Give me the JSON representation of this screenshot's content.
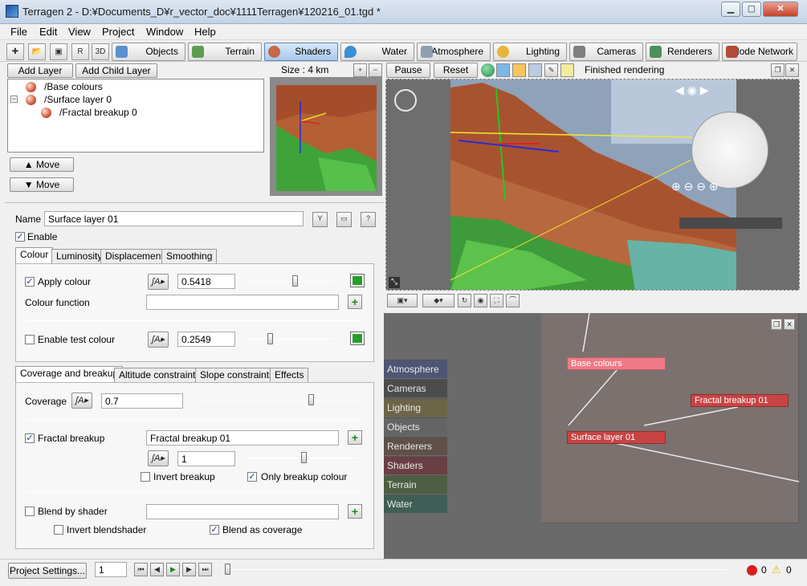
{
  "window": {
    "title": "Terragen 2 - D:¥Documents_D¥r_vector_doc¥1111Terragen¥120216_01.tgd *"
  },
  "menu": [
    "File",
    "Edit",
    "View",
    "Project",
    "Window",
    "Help"
  ],
  "tabs": [
    {
      "label": "Objects",
      "color": "#5a8fd0"
    },
    {
      "label": "Terrain",
      "color": "#5d9c52"
    },
    {
      "label": "Shaders",
      "color": "#c8674a"
    },
    {
      "label": "Water",
      "color": "#3b8fd6"
    },
    {
      "label": "Atmosphere",
      "color": "#8f9fb2"
    },
    {
      "label": "Lighting",
      "color": "#e9b43b"
    },
    {
      "label": "Cameras",
      "color": "#7f7f7f"
    },
    {
      "label": "Renderers",
      "color": "#4c8f5c"
    },
    {
      "label": "Node Network",
      "color": "#b24a3a"
    }
  ],
  "layers": {
    "add_layer": "Add Layer",
    "add_child_layer": "Add Child Layer",
    "items": [
      "/Base colours",
      "/Surface layer 0",
      "/Fractal breakup 0"
    ],
    "move_up": "Move",
    "move_down": "Move"
  },
  "preview": {
    "size_label": "Size : 4 km"
  },
  "render_bar": {
    "pause": "Pause",
    "reset": "Reset",
    "status": "Finished rendering"
  },
  "props": {
    "name_label": "Name",
    "name_value": "Surface layer 01",
    "enable_label": "Enable",
    "tabs1": [
      "Colour",
      "Luminosity",
      "Displacement",
      "Smoothing"
    ],
    "apply_colour": "Apply colour",
    "apply_value": "0.5418",
    "apply_fraction": 0.54,
    "colour_function": "Colour function",
    "enable_test": "Enable test colour",
    "test_value": "0.2549",
    "test_fraction": 0.25,
    "tabs2": [
      "Coverage and breakup",
      "Altitude constraints",
      "Slope constraints",
      "Effects"
    ],
    "coverage_label": "Coverage",
    "coverage_value": "0.7",
    "coverage_fraction": 0.7,
    "fractal_label": "Fractal breakup",
    "fractal_value": "Fractal breakup 01",
    "fractal_amount": "1",
    "fractal_fraction": 0.5,
    "invert_breakup": "Invert breakup",
    "only_breakup": "Only breakup colour",
    "blend_shader": "Blend by shader",
    "invert_blend": "Invert blendshader",
    "blend_coverage": "Blend as coverage"
  },
  "node_cats": [
    "Atmosphere",
    "Cameras",
    "Lighting",
    "Objects",
    "Renderers",
    "Shaders",
    "Terrain",
    "Water"
  ],
  "nodes": {
    "base": "Base colours",
    "fractal": "Fractal breakup 01",
    "surface": "Surface layer 01"
  },
  "bottom": {
    "project_settings": "Project Settings...",
    "frame": "1",
    "errors": "0",
    "warnings": "0"
  },
  "colors": {
    "accent_green": "#27a027",
    "node_red": "#c84444",
    "node_pink": "#ef7a86"
  }
}
